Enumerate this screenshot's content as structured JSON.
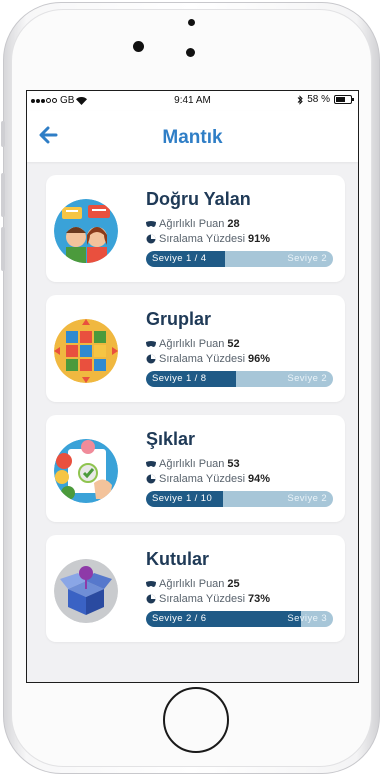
{
  "status_bar": {
    "carrier": "GB",
    "time": "9:41 AM",
    "battery": "58 %"
  },
  "navbar": {
    "back_icon": "arrow-left-icon",
    "title": "Mantık"
  },
  "stat_labels": {
    "weighted": "Ağırlıklı Puan",
    "ranking": "Sıralama Yüzdesi"
  },
  "colors": {
    "accent": "#2f7ec6",
    "progress_fill": "#1f5a86",
    "progress_track": "#a7c6d8",
    "title_text": "#1f3a57"
  },
  "cards": [
    {
      "title": "Doğru Yalan",
      "icon": "two-people-speech-icon",
      "weighted_score": "28",
      "ranking_percent": "91%",
      "level_current": "Seviye  1 / 4",
      "level_next": "Seviye  2",
      "progress": 0.42
    },
    {
      "title": "Gruplar",
      "icon": "letter-grid-icon",
      "weighted_score": "52",
      "ranking_percent": "96%",
      "level_current": "Seviye  1 / 8",
      "level_next": "Seviye  2",
      "progress": 0.48
    },
    {
      "title": "Şıklar",
      "icon": "multiple-choice-icon",
      "weighted_score": "53",
      "ranking_percent": "94%",
      "level_current": "Seviye  1 / 10",
      "level_next": "Seviye  2",
      "progress": 0.41
    },
    {
      "title": "Kutular",
      "icon": "box-cube-icon",
      "weighted_score": "25",
      "ranking_percent": "73%",
      "level_current": "Seviye  2 / 6",
      "level_next": "Seviye  3",
      "progress": 0.83
    }
  ]
}
